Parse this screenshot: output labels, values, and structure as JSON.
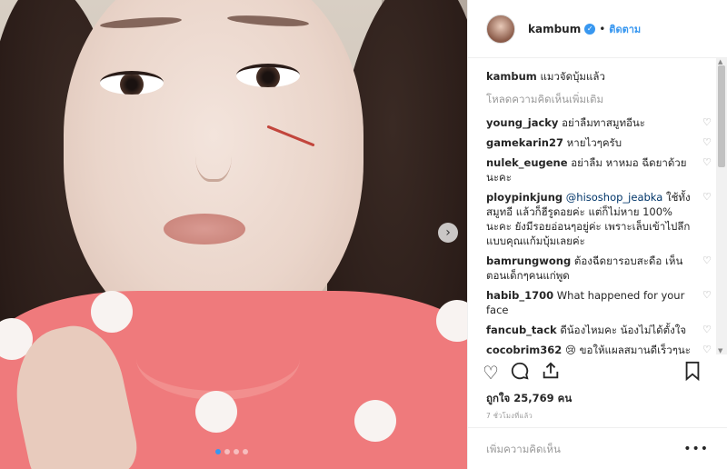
{
  "post": {
    "username": "kambum",
    "separator": "•",
    "follow_label": "ติดตาม",
    "caption_text": "แมวจัดบุ้มแล้ว",
    "load_more": "โหลดความคิดเห็นเพิ่มเติม",
    "likes": "ถูกใจ 25,769 คน",
    "time": "7 ชั่วโมงที่แล้ว",
    "add_comment_placeholder": "เพิ่มความคิดเห็น",
    "more_label": "•••"
  },
  "comments": [
    {
      "user": "young_jacky",
      "text": "อย่าลืมทาสมูทอีนะ"
    },
    {
      "user": "gamekarin27",
      "text": "หายไวๆครับ"
    },
    {
      "user": "nulek_eugene",
      "text": "อย่าลืม หาหมอ ฉีดยาด้วยนะคะ"
    },
    {
      "user": "ploypinkjung",
      "mention": "@hisoshop_jeabka",
      "text": "ใช้ทั้งสมูทอี แล้วก็ฮีรูดอยค่ะ แต่ก็ไม่หาย 100% นะคะ ยังมีรอยอ่อนๆอยู่ค่ะ เพราะเล็บเข้าไปลึกแบบคุณแก้มบุ้มเลยค่ะ"
    },
    {
      "user": "bamrungwong",
      "text": "ต้องฉีดยารอบสะดือ เห็นตอนเด็กๆคนแก่พูด"
    },
    {
      "user": "habib_1700",
      "text": "What happened for your face"
    },
    {
      "user": "fancub_tack",
      "text": "ดีน้องไหมคะ น้องไม่ได้ตั้งใจ"
    },
    {
      "user": "cocobrim362",
      "emoji": "😢",
      "text": "ขอให้แผลสมานดีเร็วๆนะคะคนสวย",
      "emoji_end": "♥"
    }
  ],
  "icons": {
    "verified": "verified-badge-icon",
    "heart": "heart-outline-icon",
    "comment": "comment-icon",
    "share": "share-icon",
    "bookmark": "bookmark-icon",
    "next": "chevron-right-icon"
  },
  "colors": {
    "accent": "#3897f0",
    "shirt": "#ef7a7c"
  }
}
